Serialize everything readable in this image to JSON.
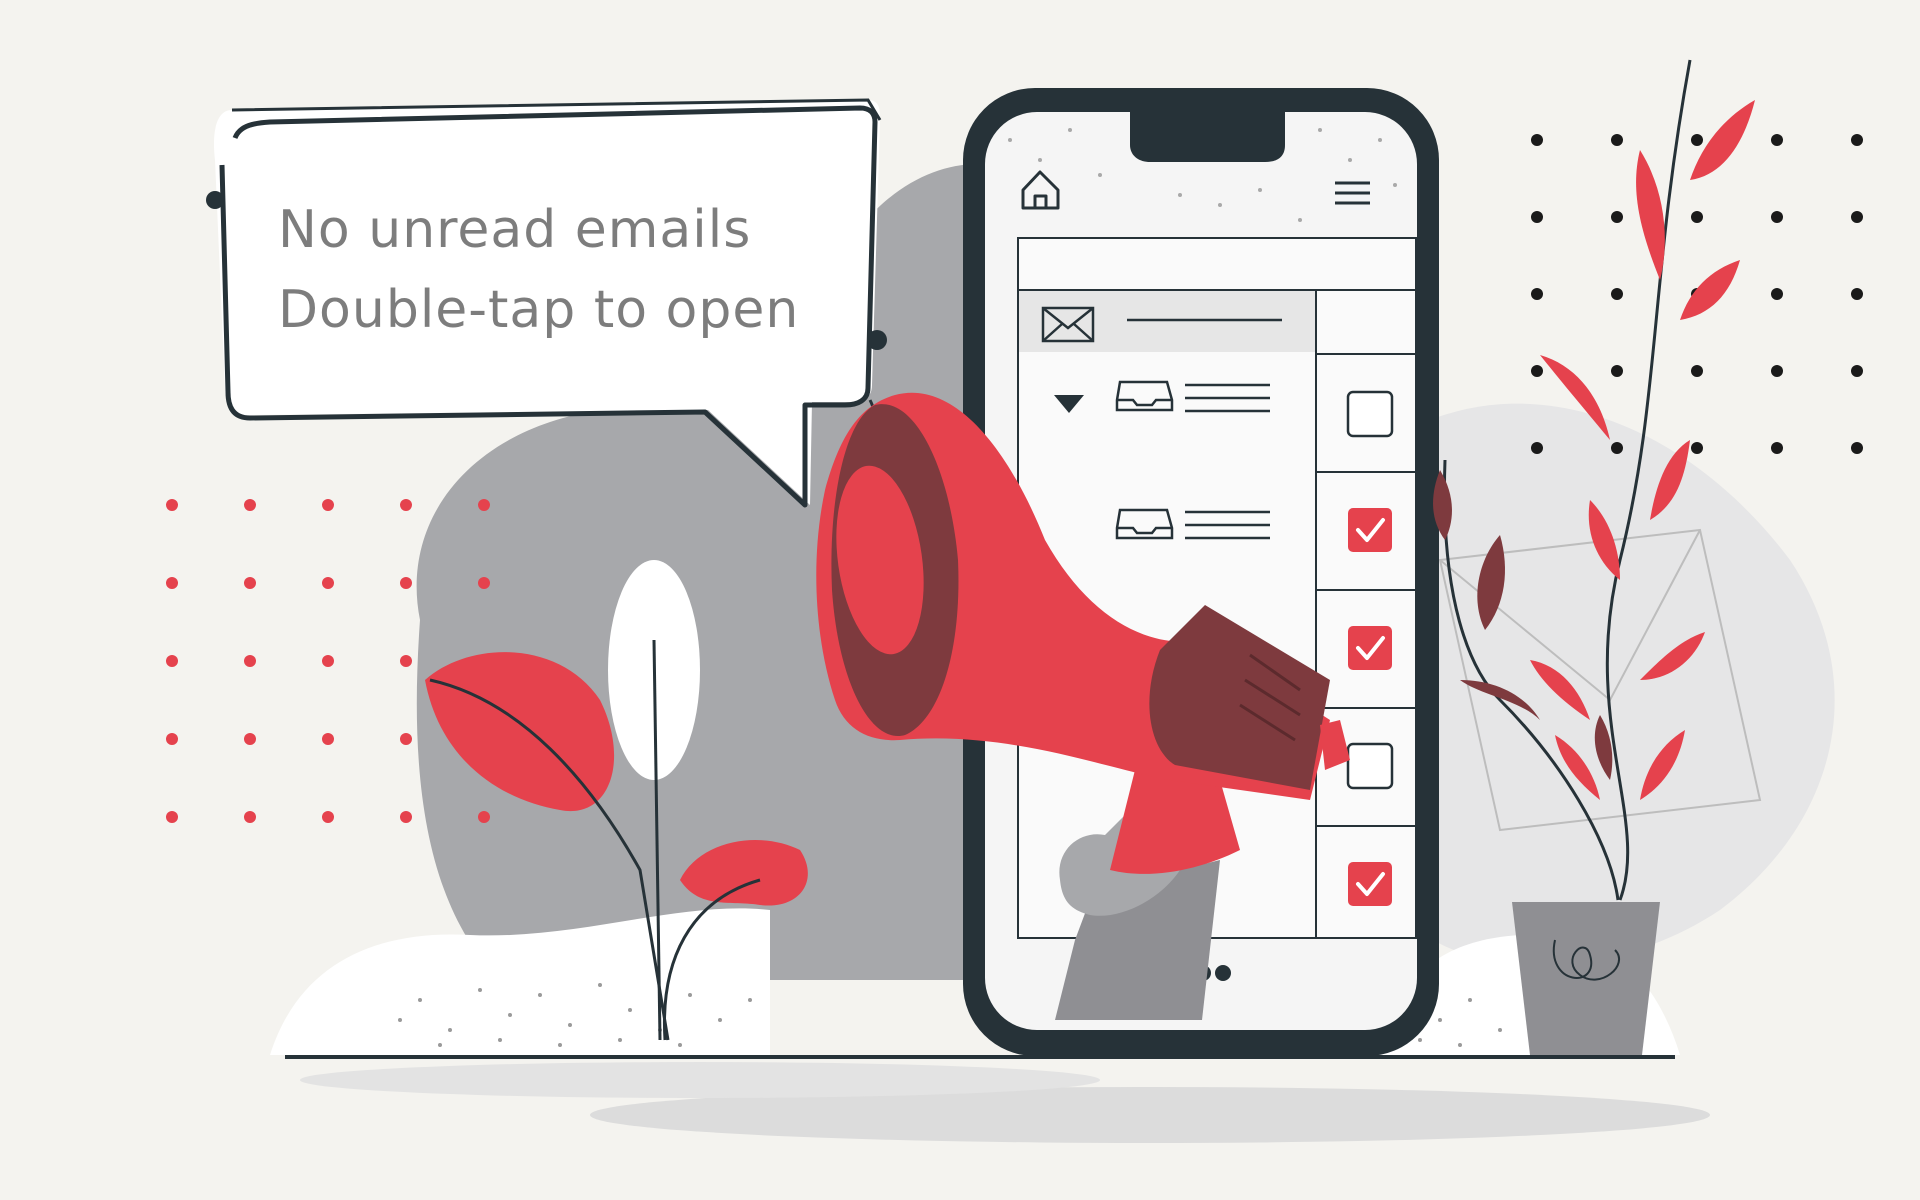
{
  "notification": {
    "line1": "No unread emails",
    "line2": "Double-tap to open"
  },
  "email_list": {
    "rows": [
      {
        "icon": "inbox-tray-icon",
        "checked": false
      },
      {
        "icon": "inbox-tray-icon",
        "checked": true
      },
      {
        "icon": "",
        "checked": true
      },
      {
        "icon": "",
        "checked": false
      },
      {
        "icon": "",
        "checked": true
      }
    ]
  },
  "icons": {
    "home": "home-icon",
    "menu": "hamburger-menu-icon",
    "mail": "envelope-icon",
    "collapse": "triangle-down-icon",
    "more": "more-dots-icon",
    "megaphone": "megaphone-icon"
  },
  "colors": {
    "background": "#f4f3ef",
    "accent_red": "#e5424d",
    "dark_red": "#7e3a3e",
    "gray_blob": "#a7a8ab",
    "phone_frame": "#263238",
    "text_gray": "#7d7d7d",
    "checkbox_red": "#e5424d"
  }
}
